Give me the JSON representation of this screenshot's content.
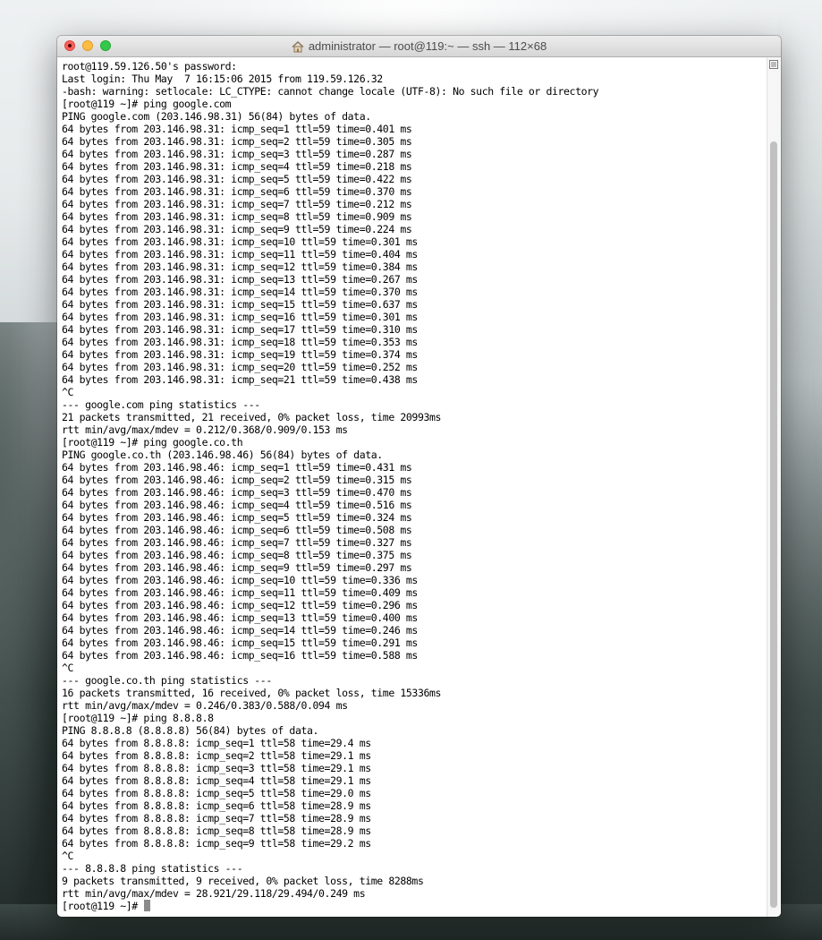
{
  "window": {
    "title": "administrator — root@119:~ — ssh — 112×68"
  },
  "terminal": {
    "lines": [
      "root@119.59.126.50's password:",
      "Last login: Thu May  7 16:15:06 2015 from 119.59.126.32",
      "-bash: warning: setlocale: LC_CTYPE: cannot change locale (UTF-8): No such file or directory",
      "[root@119 ~]# ping google.com",
      "PING google.com (203.146.98.31) 56(84) bytes of data.",
      "64 bytes from 203.146.98.31: icmp_seq=1 ttl=59 time=0.401 ms",
      "64 bytes from 203.146.98.31: icmp_seq=2 ttl=59 time=0.305 ms",
      "64 bytes from 203.146.98.31: icmp_seq=3 ttl=59 time=0.287 ms",
      "64 bytes from 203.146.98.31: icmp_seq=4 ttl=59 time=0.218 ms",
      "64 bytes from 203.146.98.31: icmp_seq=5 ttl=59 time=0.422 ms",
      "64 bytes from 203.146.98.31: icmp_seq=6 ttl=59 time=0.370 ms",
      "64 bytes from 203.146.98.31: icmp_seq=7 ttl=59 time=0.212 ms",
      "64 bytes from 203.146.98.31: icmp_seq=8 ttl=59 time=0.909 ms",
      "64 bytes from 203.146.98.31: icmp_seq=9 ttl=59 time=0.224 ms",
      "64 bytes from 203.146.98.31: icmp_seq=10 ttl=59 time=0.301 ms",
      "64 bytes from 203.146.98.31: icmp_seq=11 ttl=59 time=0.404 ms",
      "64 bytes from 203.146.98.31: icmp_seq=12 ttl=59 time=0.384 ms",
      "64 bytes from 203.146.98.31: icmp_seq=13 ttl=59 time=0.267 ms",
      "64 bytes from 203.146.98.31: icmp_seq=14 ttl=59 time=0.370 ms",
      "64 bytes from 203.146.98.31: icmp_seq=15 ttl=59 time=0.637 ms",
      "64 bytes from 203.146.98.31: icmp_seq=16 ttl=59 time=0.301 ms",
      "64 bytes from 203.146.98.31: icmp_seq=17 ttl=59 time=0.310 ms",
      "64 bytes from 203.146.98.31: icmp_seq=18 ttl=59 time=0.353 ms",
      "64 bytes from 203.146.98.31: icmp_seq=19 ttl=59 time=0.374 ms",
      "64 bytes from 203.146.98.31: icmp_seq=20 ttl=59 time=0.252 ms",
      "64 bytes from 203.146.98.31: icmp_seq=21 ttl=59 time=0.438 ms",
      "^C",
      "--- google.com ping statistics ---",
      "21 packets transmitted, 21 received, 0% packet loss, time 20993ms",
      "rtt min/avg/max/mdev = 0.212/0.368/0.909/0.153 ms",
      "[root@119 ~]# ping google.co.th",
      "PING google.co.th (203.146.98.46) 56(84) bytes of data.",
      "64 bytes from 203.146.98.46: icmp_seq=1 ttl=59 time=0.431 ms",
      "64 bytes from 203.146.98.46: icmp_seq=2 ttl=59 time=0.315 ms",
      "64 bytes from 203.146.98.46: icmp_seq=3 ttl=59 time=0.470 ms",
      "64 bytes from 203.146.98.46: icmp_seq=4 ttl=59 time=0.516 ms",
      "64 bytes from 203.146.98.46: icmp_seq=5 ttl=59 time=0.324 ms",
      "64 bytes from 203.146.98.46: icmp_seq=6 ttl=59 time=0.508 ms",
      "64 bytes from 203.146.98.46: icmp_seq=7 ttl=59 time=0.327 ms",
      "64 bytes from 203.146.98.46: icmp_seq=8 ttl=59 time=0.375 ms",
      "64 bytes from 203.146.98.46: icmp_seq=9 ttl=59 time=0.297 ms",
      "64 bytes from 203.146.98.46: icmp_seq=10 ttl=59 time=0.336 ms",
      "64 bytes from 203.146.98.46: icmp_seq=11 ttl=59 time=0.409 ms",
      "64 bytes from 203.146.98.46: icmp_seq=12 ttl=59 time=0.296 ms",
      "64 bytes from 203.146.98.46: icmp_seq=13 ttl=59 time=0.400 ms",
      "64 bytes from 203.146.98.46: icmp_seq=14 ttl=59 time=0.246 ms",
      "64 bytes from 203.146.98.46: icmp_seq=15 ttl=59 time=0.291 ms",
      "64 bytes from 203.146.98.46: icmp_seq=16 ttl=59 time=0.588 ms",
      "^C",
      "--- google.co.th ping statistics ---",
      "16 packets transmitted, 16 received, 0% packet loss, time 15336ms",
      "rtt min/avg/max/mdev = 0.246/0.383/0.588/0.094 ms",
      "[root@119 ~]# ping 8.8.8.8",
      "PING 8.8.8.8 (8.8.8.8) 56(84) bytes of data.",
      "64 bytes from 8.8.8.8: icmp_seq=1 ttl=58 time=29.4 ms",
      "64 bytes from 8.8.8.8: icmp_seq=2 ttl=58 time=29.1 ms",
      "64 bytes from 8.8.8.8: icmp_seq=3 ttl=58 time=29.1 ms",
      "64 bytes from 8.8.8.8: icmp_seq=4 ttl=58 time=29.1 ms",
      "64 bytes from 8.8.8.8: icmp_seq=5 ttl=58 time=29.0 ms",
      "64 bytes from 8.8.8.8: icmp_seq=6 ttl=58 time=28.9 ms",
      "64 bytes from 8.8.8.8: icmp_seq=7 ttl=58 time=28.9 ms",
      "64 bytes from 8.8.8.8: icmp_seq=8 ttl=58 time=28.9 ms",
      "64 bytes from 8.8.8.8: icmp_seq=9 ttl=58 time=29.2 ms",
      "^C",
      "--- 8.8.8.8 ping statistics ---",
      "9 packets transmitted, 9 received, 0% packet loss, time 8288ms",
      "rtt min/avg/max/mdev = 28.921/29.118/29.494/0.249 ms"
    ],
    "prompt": "[root@119 ~]# "
  },
  "colors": {
    "close": "#fc605c",
    "minimize": "#fdbc40",
    "maximize": "#34c84a",
    "terminal_bg": "#ffffff",
    "terminal_fg": "#000000"
  }
}
